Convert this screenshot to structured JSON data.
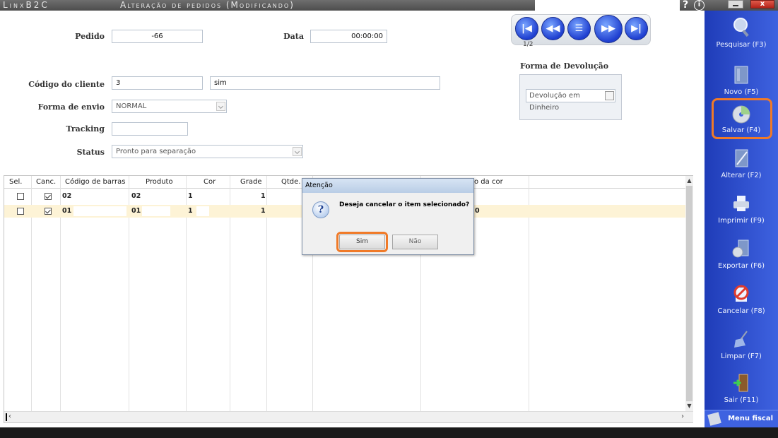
{
  "window": {
    "app_name": "LinxB2C",
    "title": "Alteração de pedidos (Modificando)",
    "help_glyph": "?",
    "info_glyph": "i",
    "close_glyph": "x"
  },
  "form": {
    "pedido_label": "Pedido",
    "pedido_value": "-66",
    "data_label": "Data",
    "data_value": "00:00:00",
    "codigo_cliente_label": "Código do cliente",
    "codigo_cliente_value": "3",
    "cliente_nome_value": "sim",
    "forma_envio_label": "Forma de envio",
    "forma_envio_value": "NORMAL",
    "tracking_label": "Tracking",
    "tracking_value": "",
    "status_label": "Status",
    "status_value": "Pronto para separação"
  },
  "nav": {
    "counter": "1/2",
    "first_glyph": "|◀",
    "prev_glyph": "◀◀",
    "list_glyph": "☰",
    "next_glyph": "▶▶",
    "last_glyph": "▶|"
  },
  "devolucao": {
    "title": "Forma de Devolução",
    "value": "Devolução em Dinheiro"
  },
  "grid": {
    "headers": {
      "sel": "Sel.",
      "canc": "Canc.",
      "codigo_barras": "Código de barras",
      "produto": "Produto",
      "cor": "Cor",
      "grade": "Grade",
      "qtde": "Qtde.",
      "desc_cor": "o da cor"
    },
    "rows": [
      {
        "sel": false,
        "canc": true,
        "codigo_barras": "02",
        "produto": "02",
        "cor": "1",
        "grade": "1",
        "extra": ""
      },
      {
        "sel": false,
        "canc": true,
        "codigo_barras": "01",
        "produto": "01",
        "cor": "1",
        "grade": "1",
        "extra": "0"
      }
    ]
  },
  "dialog": {
    "title": "Atenção",
    "icon": "question-icon",
    "icon_glyph": "?",
    "message": "Deseja cancelar o item selecionado?",
    "yes_label": "Sim",
    "no_label": "Não"
  },
  "toolbar": {
    "items": [
      {
        "label": "Pesquisar (F3)",
        "icon": "search-icon"
      },
      {
        "label": "Novo (F5)",
        "icon": "new-document-icon"
      },
      {
        "label": "Salvar (F4)",
        "icon": "disc-save-icon"
      },
      {
        "label": "Alterar (F2)",
        "icon": "edit-pencil-icon"
      },
      {
        "label": "Imprimir (F9)",
        "icon": "printer-icon"
      },
      {
        "label": "Exportar (F6)",
        "icon": "export-icon"
      },
      {
        "label": "Cancelar (F8)",
        "icon": "cancel-icon"
      },
      {
        "label": "Limpar (F7)",
        "icon": "broom-icon"
      },
      {
        "label": "Sair (F11)",
        "icon": "exit-door-icon"
      }
    ],
    "menu_fiscal_label": "Menu fiscal"
  },
  "colors": {
    "toolbar_blue": "#2f4fd0",
    "highlight_orange": "#f07a28",
    "selected_row": "#fdf3d6"
  }
}
